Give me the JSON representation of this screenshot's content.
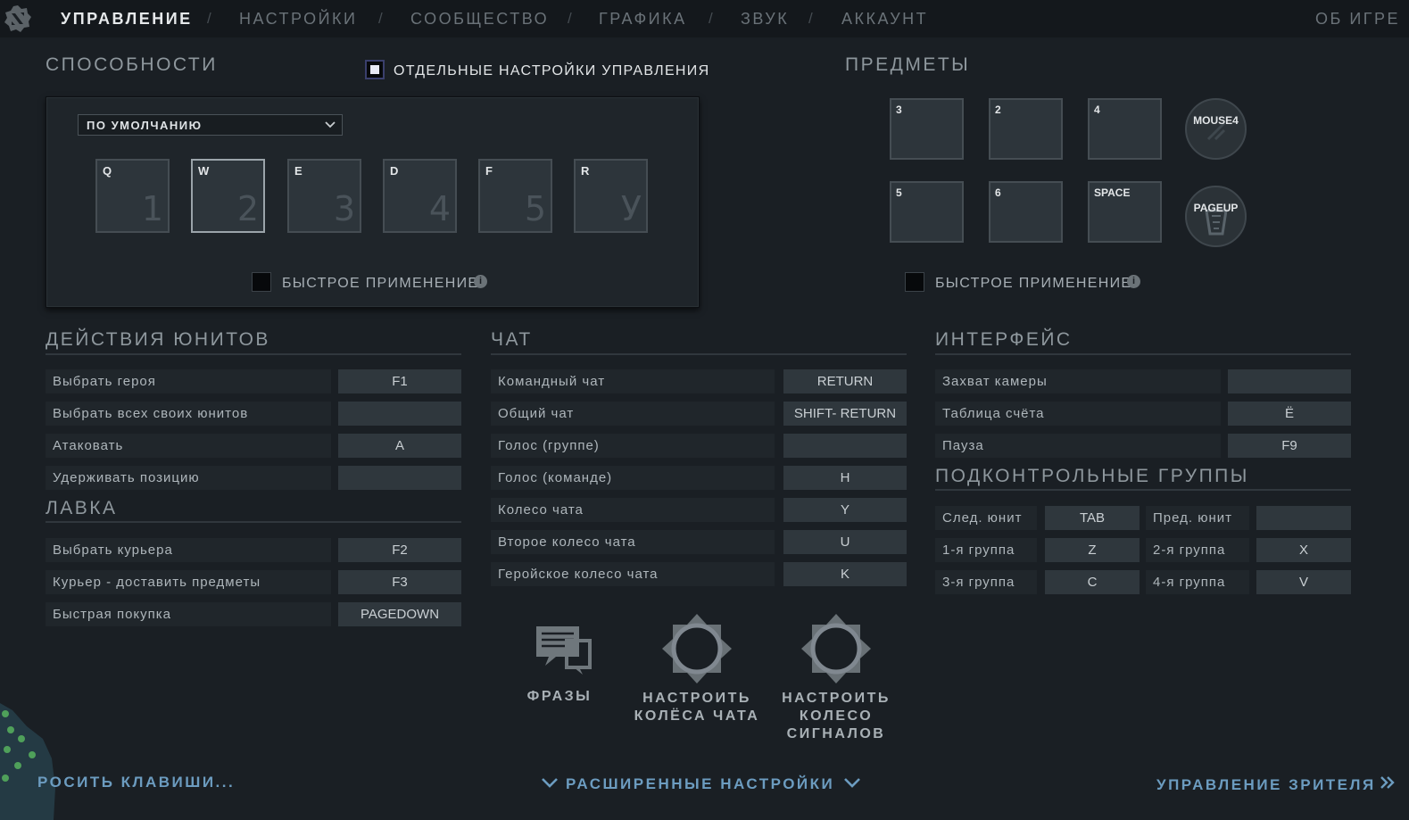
{
  "nav": {
    "tabs": [
      "УПРАВЛЕНИЕ",
      "НАСТРОЙКИ",
      "СООБЩЕСТВО",
      "ГРАФИКА",
      "ЗВУК",
      "АККАУНТ"
    ],
    "separator": "/",
    "about": "ОБ ИГРЕ"
  },
  "abilities": {
    "title": "СПОСОБНОСТИ",
    "separate_settings": "ОТДЕЛЬНЫЕ НАСТРОЙКИ УПРАВЛЕНИЯ",
    "preset": "ПО УМОЛЧАНИЮ",
    "keys": [
      {
        "key": "Q",
        "num": "1"
      },
      {
        "key": "W",
        "num": "2"
      },
      {
        "key": "E",
        "num": "3"
      },
      {
        "key": "D",
        "num": "4"
      },
      {
        "key": "F",
        "num": "5"
      },
      {
        "key": "R",
        "num": "У"
      }
    ],
    "quickcast": "БЫСТРОЕ ПРИМЕНЕНИЕ"
  },
  "items": {
    "title": "ПРЕДМЕТЫ",
    "slots": [
      "3",
      "2",
      "4",
      "5",
      "6",
      "SPACE"
    ],
    "neutral_key": "MOUSE4",
    "tp_key": "PAGEUP",
    "quickcast": "БЫСТРОЕ ПРИМЕНЕНИЕ"
  },
  "unit_actions": {
    "title": "ДЕЙСТВИЯ ЮНИТОВ",
    "rows": [
      {
        "label": "Выбрать героя",
        "key": "F1"
      },
      {
        "label": "Выбрать всех своих юнитов",
        "key": ""
      },
      {
        "label": "Атаковать",
        "key": "A"
      },
      {
        "label": "Удерживать позицию",
        "key": ""
      }
    ]
  },
  "shop": {
    "title": "ЛАВКА",
    "rows": [
      {
        "label": "Выбрать курьера",
        "key": "F2"
      },
      {
        "label": "Курьер - доставить предметы",
        "key": "F3"
      },
      {
        "label": "Быстрая покупка",
        "key": "PAGEDOWN"
      }
    ]
  },
  "chat": {
    "title": "ЧАТ",
    "rows": [
      {
        "label": "Командный чат",
        "key": "RETURN"
      },
      {
        "label": "Общий чат",
        "key": "SHIFT- RETURN"
      },
      {
        "label": "Голос (группе)",
        "key": ""
      },
      {
        "label": "Голос (команде)",
        "key": "H"
      },
      {
        "label": "Колесо чата",
        "key": "Y"
      },
      {
        "label": "Второе колесо чата",
        "key": "U"
      },
      {
        "label": "Геройское колесо чата",
        "key": "K"
      }
    ]
  },
  "interface": {
    "title": "ИНТЕРФЕЙС",
    "rows": [
      {
        "label": "Захват камеры",
        "key": ""
      },
      {
        "label": "Таблица счёта",
        "key": "Ё"
      },
      {
        "label": "Пауза",
        "key": "F9"
      }
    ]
  },
  "control_groups": {
    "title": "ПОДКОНТРОЛЬНЫЕ ГРУППЫ",
    "rows": [
      {
        "l1": "След. юнит",
        "k1": "TAB",
        "l2": "Пред. юнит",
        "k2": ""
      },
      {
        "l1": "1-я группа",
        "k1": "Z",
        "l2": "2-я группа",
        "k2": "X"
      },
      {
        "l1": "3-я группа",
        "k1": "C",
        "l2": "4-я группа",
        "k2": "V"
      }
    ]
  },
  "buttons": {
    "phrases": "ФРАЗЫ",
    "chat_wheels": [
      "НАСТРОИТЬ",
      "КОЛЁСА ЧАТА"
    ],
    "ping_wheel": [
      "НАСТРОИТЬ",
      "КОЛЕСО",
      "СИГНАЛОВ"
    ]
  },
  "footer": {
    "reset": "РОСИТЬ КЛАВИШИ...",
    "advanced": "РАСШИРЕННЫЕ НАСТРОЙКИ",
    "spectator": "УПРАВЛЕНИЕ ЗРИТЕЛЯ"
  },
  "colors": {
    "background": "#1a1f24",
    "accent_link": "#6c9cc0"
  }
}
